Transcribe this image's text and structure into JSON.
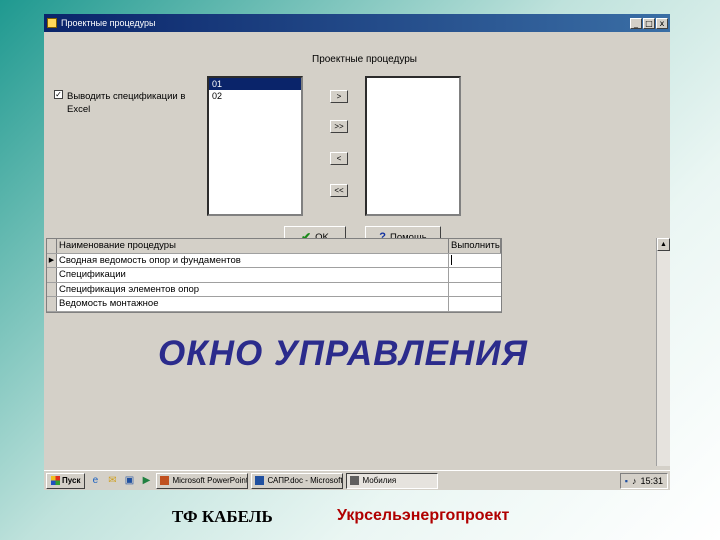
{
  "window": {
    "title": "Проектные процедуры",
    "controls": [
      "_",
      "□",
      "x"
    ]
  },
  "dialog": {
    "title": "Проектные процедуры",
    "checkbox": {
      "checked": true,
      "label": "Выводить спецификации в Excel"
    },
    "left_list": {
      "items": [
        "01",
        "02"
      ],
      "selected_index": 0
    },
    "move_buttons": [
      ">",
      ">>",
      "<",
      "<<"
    ],
    "ok_label": "OK",
    "help_label": "Помощь"
  },
  "grid": {
    "columns": [
      "Наименование процедуры",
      "Выполнить"
    ],
    "rows": [
      [
        "Сводная ведомость опор и фундаментов",
        ""
      ],
      [
        "Спецификации",
        ""
      ],
      [
        "Спецификация элементов опор",
        ""
      ],
      [
        "Ведомость монтажное",
        ""
      ]
    ],
    "current_row": 0
  },
  "headline": "ОКНО УПРАВЛЕНИЯ",
  "taskbar": {
    "start_label": "Пуск",
    "tasks": [
      {
        "label": "Microsoft PowerPoint - [Б...",
        "icon": "powerpoint-icon",
        "color": "#c0501f",
        "active": false
      },
      {
        "label": "САПР.doc - Microsoft Word",
        "icon": "word-icon",
        "color": "#2050a0",
        "active": false
      },
      {
        "label": "Мобилия",
        "icon": "app-icon",
        "color": "#606060",
        "active": true
      }
    ],
    "clock": "15:31"
  },
  "footer": {
    "left": "ТФ КАБЕЛЬ",
    "right": "Укрсельэнергопроект"
  },
  "colors": {
    "titlebar": "#0a246a",
    "headline": "#2b2b8c",
    "footer_right": "#b00000"
  }
}
